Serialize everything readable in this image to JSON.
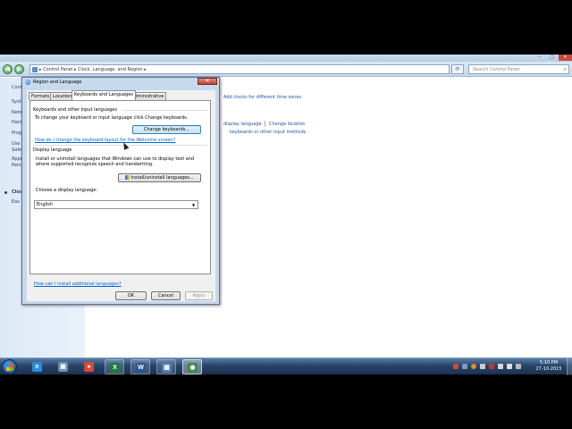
{
  "explorer": {
    "breadcrumb": [
      "Control Panel",
      "Clock, Language, and Region"
    ],
    "breadcrumb_text": "▸  Control Panel  ▸  Clock, Language, and Region  ▸",
    "search_placeholder": "Search Control Panel",
    "left_nav": [
      "Cont",
      "Syst",
      "Netw",
      "Hard",
      "Prog",
      "Use",
      "Safe",
      "Appe",
      "Pers",
      "Clock",
      "Eas"
    ],
    "links": {
      "add_clocks": "Add clocks for different time zones",
      "display_language": "display language",
      "change_location": "Change location",
      "keyboards": "keyboards or other input methods"
    }
  },
  "dialog": {
    "title": "Region and Language",
    "tabs": [
      "Formats",
      "Location",
      "Keyboards and Languages",
      "Administrative"
    ],
    "active_tab": "Keyboards and Languages",
    "keyboards_group": {
      "label": "Keyboards and other input languages",
      "desc": "To change your keyboard or input language click Change keyboards.",
      "button": "Change keyboards...",
      "link": "How do I change the keyboard layout for the Welcome screen?"
    },
    "display_group": {
      "label": "Display language",
      "desc_line1": "Install or uninstall languages that Windows can use to display text and",
      "desc_line2": "where supported recognize speech and handwriting.",
      "install_button": "Install/uninstall languages...",
      "choose_label": "Choose a display language:",
      "selected_language": "English"
    },
    "bottom_link": "How can I install additional languages?",
    "buttons": {
      "ok": "OK",
      "cancel": "Cancel",
      "apply": "Apply"
    }
  },
  "taskbar": {
    "apps": [
      {
        "name": "internet-explorer",
        "glyph": "e",
        "color": "#2a8ddb"
      },
      {
        "name": "computer",
        "glyph": "▣",
        "color": "#6a8fb8"
      },
      {
        "name": "chrome",
        "glyph": "●",
        "color": "#d9473a"
      },
      {
        "name": "excel",
        "glyph": "X",
        "color": "#1f7a3d"
      },
      {
        "name": "word",
        "glyph": "W",
        "color": "#2b5797"
      },
      {
        "name": "control-panel",
        "glyph": "▦",
        "color": "#4e7fb8"
      },
      {
        "name": "region-language",
        "glyph": "◉",
        "color": "#3a8c4a"
      }
    ],
    "time": "5:10 PM",
    "date": "27-10-2015"
  }
}
